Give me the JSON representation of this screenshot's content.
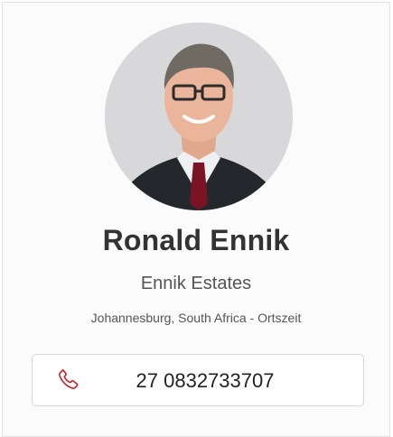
{
  "profile": {
    "name": "Ronald Ennik",
    "company": "Ennik Estates",
    "location": "Johannesburg, South Africa - Ortszeit"
  },
  "contact": {
    "phone": "27 0832733707",
    "phone_icon": "phone-icon"
  },
  "colors": {
    "accent": "#c8202c",
    "name_text": "#333333",
    "secondary_text": "#555555"
  }
}
